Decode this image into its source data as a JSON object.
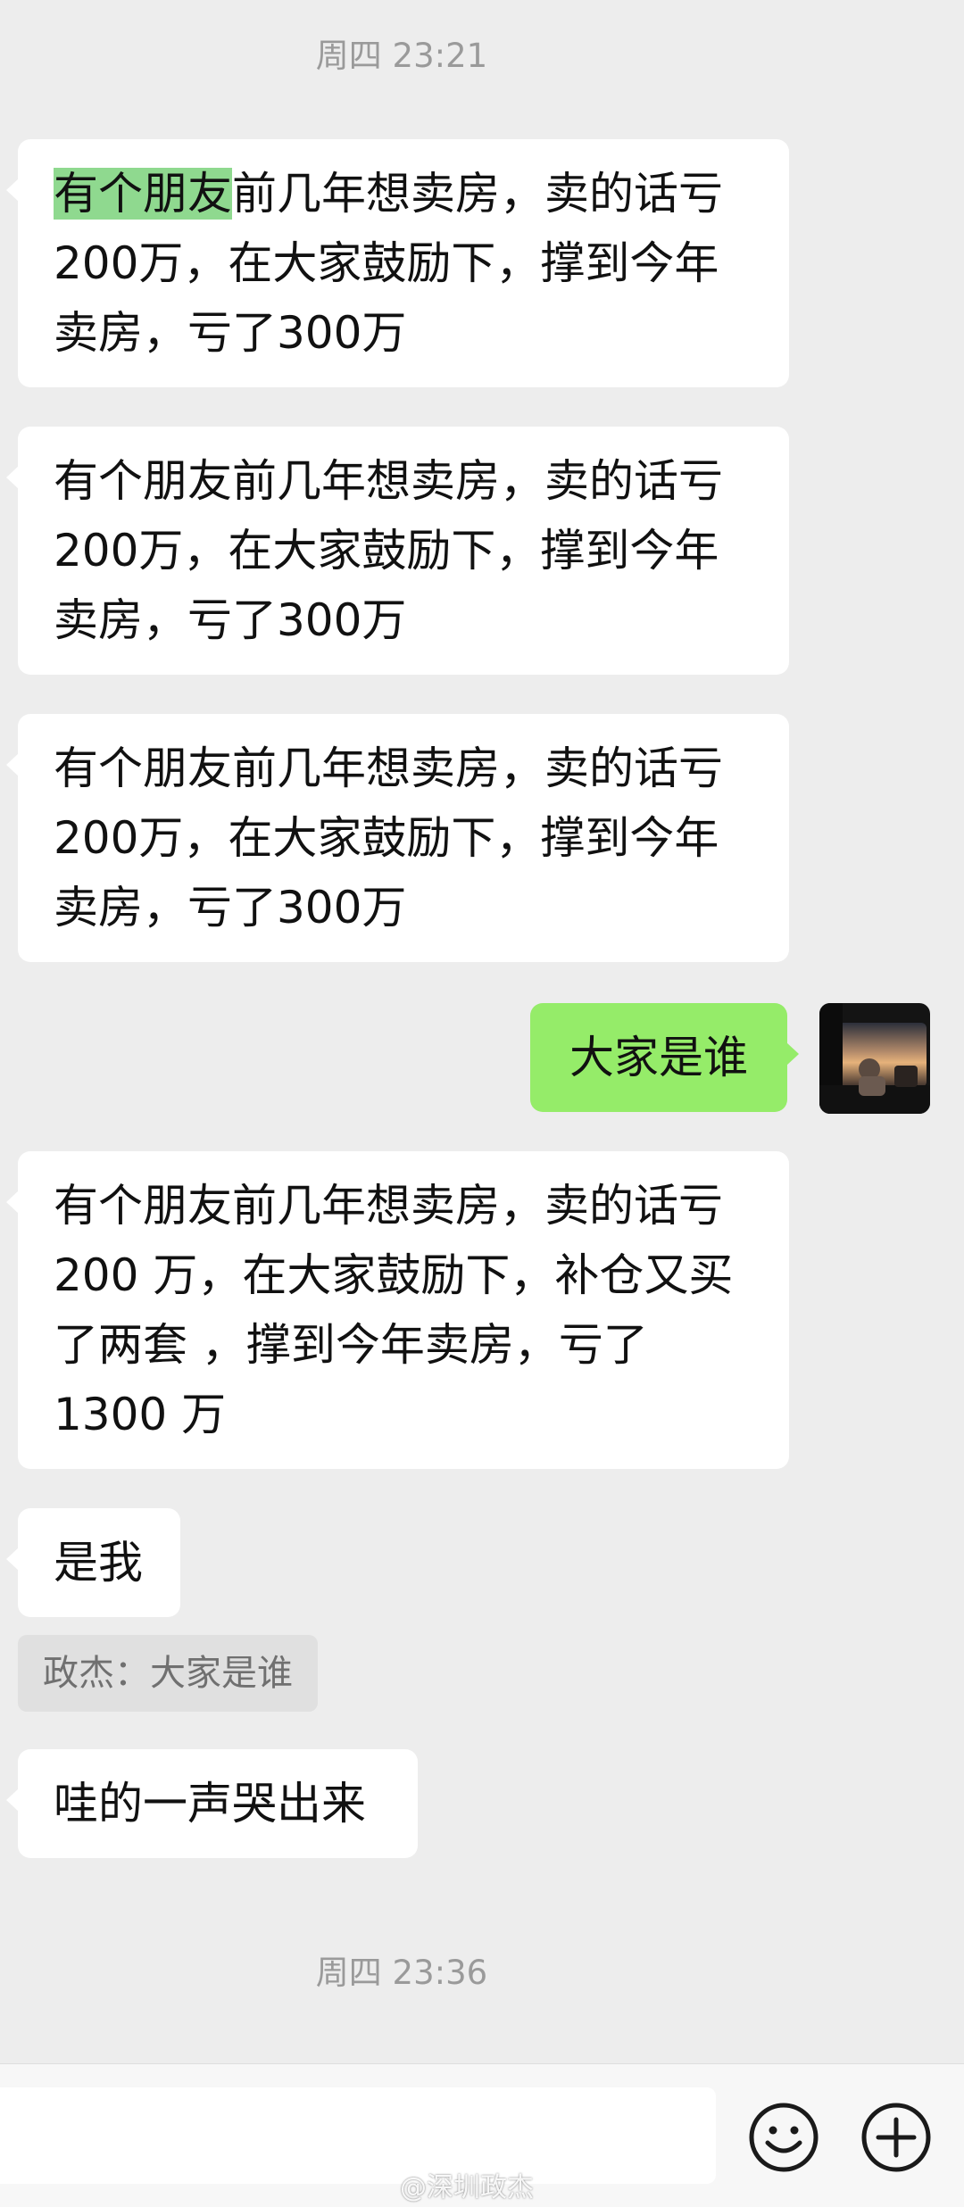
{
  "chat": {
    "timestamps": [
      "周四 23:21",
      "周四 23:36"
    ],
    "messages": [
      {
        "side": "left",
        "highlight": "有个朋友",
        "rest": "前几年想卖房，卖的话亏\n200万，在大家鼓励下，撑到今年\n卖房，亏了300万"
      },
      {
        "side": "left",
        "text": "有个朋友前几年想卖房，卖的话亏\n200万，在大家鼓励下，撑到今年\n卖房，亏了300万"
      },
      {
        "side": "left",
        "text": "有个朋友前几年想卖房，卖的话亏\n200万，在大家鼓励下，撑到今年\n卖房，亏了300万"
      },
      {
        "side": "right",
        "text": "大家是谁"
      },
      {
        "side": "left",
        "text": "有个朋友前几年想卖房，卖的话亏\n200 万，在大家鼓励下，补仓又买\n了两套 ，撑到今年卖房，亏了\n1300 万"
      },
      {
        "side": "left",
        "text": "是我"
      },
      {
        "side": "left",
        "text": "哇的一声哭出来"
      }
    ],
    "quote": "政杰：大家是谁"
  },
  "input_bar": {
    "placeholder": "",
    "emoji_icon": "smiley-icon",
    "plus_icon": "plus-circle-icon"
  },
  "watermark": "@深圳政杰",
  "colors": {
    "background": "#ededed",
    "bubble_left": "#ffffff",
    "bubble_right": "#95ec69",
    "highlight": "#8fd98f"
  }
}
